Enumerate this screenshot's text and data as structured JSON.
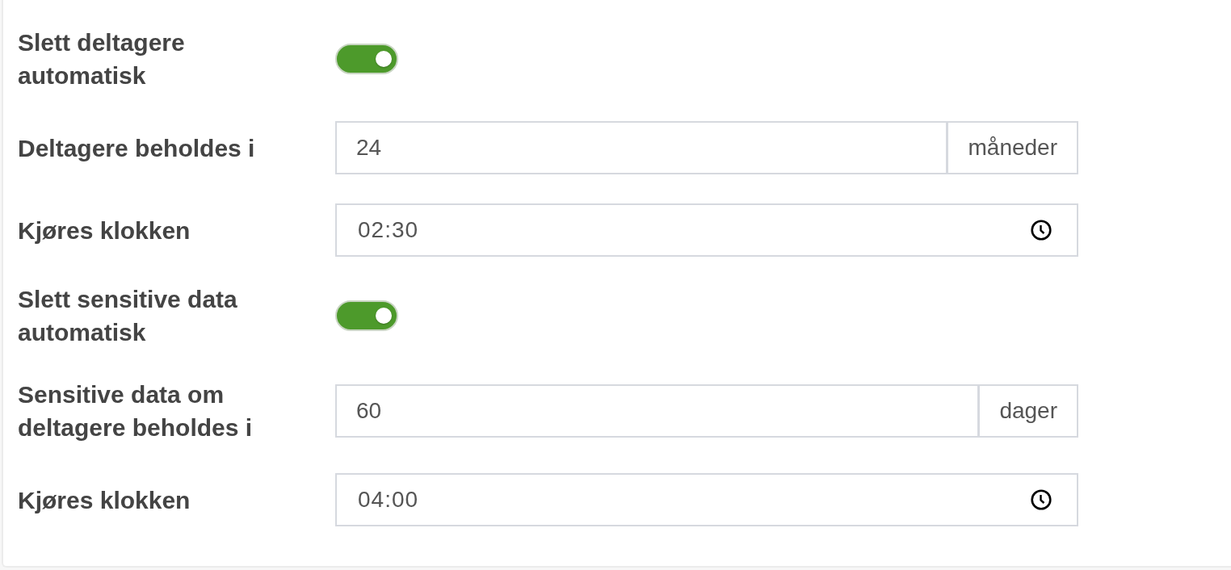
{
  "settings": [
    {
      "kind": "toggle",
      "label": "Slett deltagere automatisk",
      "on": true
    },
    {
      "kind": "number",
      "label": "Deltagere beholdes i",
      "value": "24",
      "unit": "måneder"
    },
    {
      "kind": "time",
      "label": "Kjøres klokken",
      "value": "02:30"
    },
    {
      "kind": "toggle",
      "label": "Slett sensitive data automatisk",
      "on": true
    },
    {
      "kind": "number",
      "label": "Sensitive data om deltagere beholdes i",
      "value": "60",
      "unit": "dager"
    },
    {
      "kind": "time",
      "label": "Kjøres klokken",
      "value": "04:00"
    }
  ]
}
